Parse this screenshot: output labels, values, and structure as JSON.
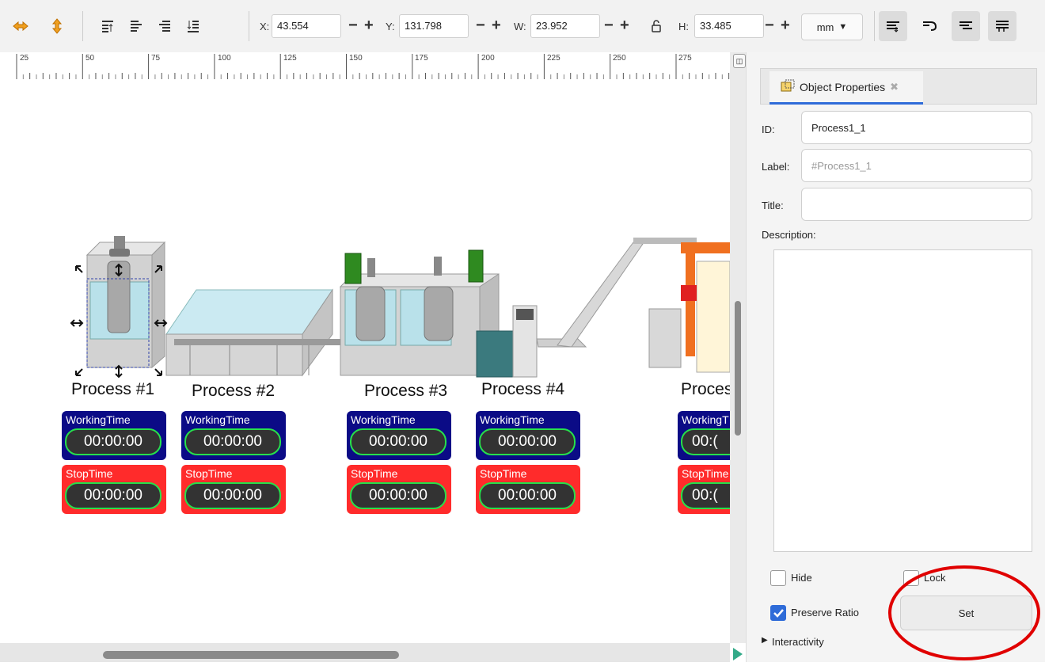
{
  "toolbar": {
    "x_label": "X:",
    "x_value": "43.554",
    "y_label": "Y:",
    "y_value": "131.798",
    "w_label": "W:",
    "w_value": "23.952",
    "h_label": "H:",
    "h_value": "33.485",
    "minus": "−",
    "plus": "+",
    "unit": "mm"
  },
  "ruler": {
    "ticks": [
      "25",
      "50",
      "75",
      "100",
      "125",
      "150",
      "175",
      "200",
      "225",
      "250",
      "275"
    ]
  },
  "canvas": {
    "processes": [
      "Process #1",
      "Process #2",
      "Process #3",
      "Process #4",
      "Proces"
    ],
    "working_title": "WorkingTime",
    "working_title_cut": "WorkingT",
    "stop_title": "StopTime",
    "stop_title_cut": "StopTime",
    "timer_value": "00:00:00",
    "timer_value_cut": "00:("
  },
  "panel": {
    "tab_label": "Object Properties",
    "id_label": "ID:",
    "id_value": "Process1_1",
    "label_label": "Label:",
    "label_placeholder": "#Process1_1",
    "title_label": "Title:",
    "title_value": "",
    "description_label": "Description:",
    "hide_label": "Hide",
    "lock_label": "Lock",
    "preserve_ratio_label": "Preserve Ratio",
    "preserve_ratio_checked": true,
    "set_button": "Set",
    "interactivity_label": "Interactivity"
  },
  "colors": {
    "accent": "#2e6bd8",
    "working_bg": "#0b0b86",
    "stop_bg": "#ff2b2b",
    "timer_border": "#27e04b",
    "highlight_circle": "#e00000"
  }
}
